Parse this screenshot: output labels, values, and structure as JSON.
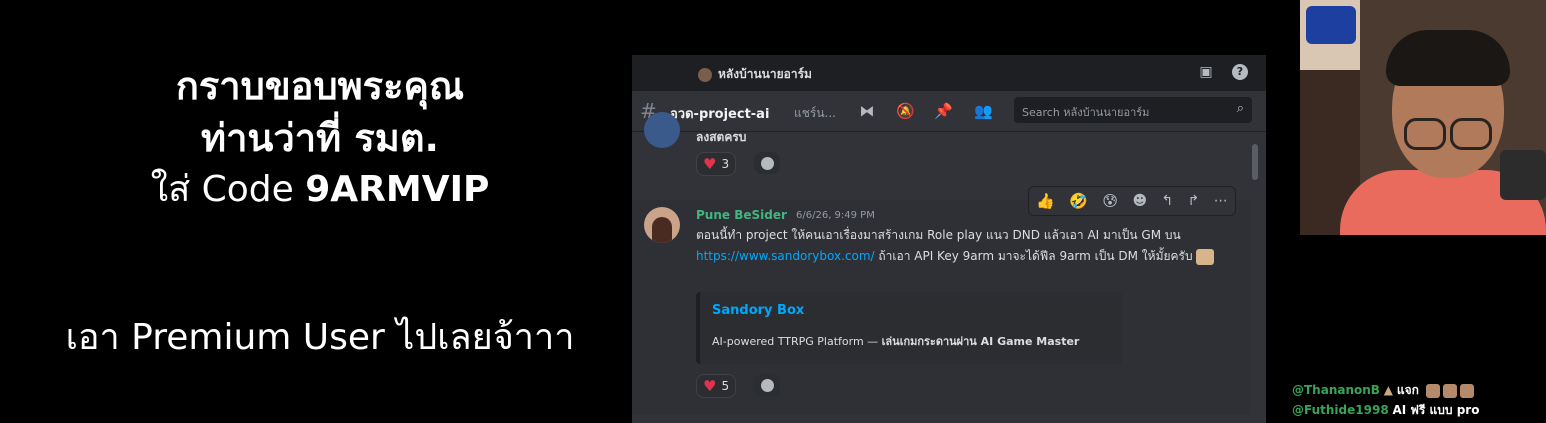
{
  "overlay": {
    "line1": "กราบขอบพระคุณ",
    "line2": "ท่านว่าที่ รมต.",
    "code_prefix": "ใส่ Code ",
    "code_value": "9ARMVIP",
    "premium": "เอา Premium User ไปเลยจ้าาา"
  },
  "discord": {
    "server_name": "หลังบ้านนายอาร์ม",
    "channel_name": "อวด-project-ai",
    "channel_topic": "แชร์น...",
    "search_placeholder": "Search หลังบ้านนายอาร์ม",
    "prev_message_text": "ลงสตครบ",
    "prev_reaction_count": "3",
    "message": {
      "author": "Pune BeSider",
      "timestamp": "6/6/26, 9:49 PM",
      "text_part1": "ตอนนี้ทำ project ให้คนเอาเรื่องมาสร้างเกม Role play แนว DND แล้วเอา AI มาเป็น GM บน ",
      "link": "https://www.sandorybox.com/",
      "text_part2": " ถ้าเอา API Key 9arm มาจะได้ฟีล 9arm เป็น DM ให้มั้ยครับ",
      "embed_title": "Sandory Box",
      "embed_desc_prefix": "AI-powered TTRPG Platform — ",
      "embed_desc_bold": "เล่นเกมกระดานผ่าน AI Game Master",
      "reaction_count": "5"
    },
    "toolbar_emojis": [
      "👍",
      "🤣",
      "😰"
    ]
  },
  "chat": {
    "row1_user": "@ThananonB",
    "row1_text": "แจก",
    "row2_user": "@Futhide1998",
    "row2_text": "AI ฟรี แบบ pro"
  },
  "colors": {
    "discord_bg": "#313338",
    "link": "#00a8fc",
    "author": "#43b581",
    "heart": "#e0334f"
  }
}
